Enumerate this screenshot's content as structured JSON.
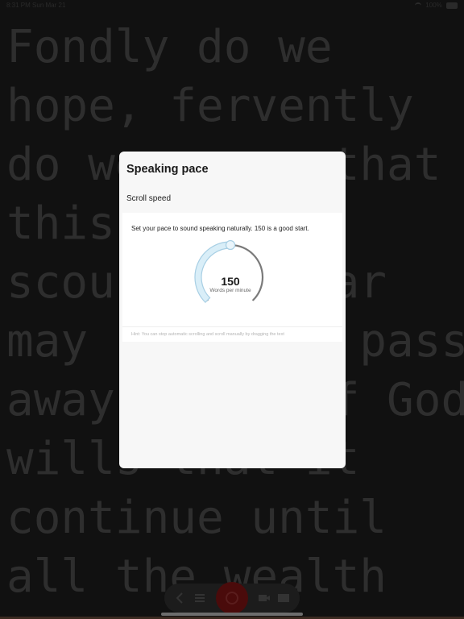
{
  "status_bar": {
    "time": "8:31 PM",
    "date": "Sun Mar 21",
    "battery": "100%"
  },
  "script": {
    "lines": [
      "Fondly do we",
      "hope, fervently",
      "do we pray, that",
      "this mighty",
      "scourge of war",
      "may speedily pass",
      "away. Yet, if God",
      "wills that it",
      "continue until",
      "all the wealth"
    ]
  },
  "dialog": {
    "title": "Speaking pace",
    "section_label": "Scroll speed",
    "description": "Set your pace to sound speaking naturally. 150 is a good start.",
    "gauge": {
      "value": "150",
      "unit": "Words per minute",
      "level_fraction": 0.5
    },
    "hint": "Hint: You can stop automatic scrolling and scroll manually by dragging the text"
  },
  "toolbar": {
    "items": [
      "back-icon",
      "menu-icon",
      "record-icon",
      "camera-icon",
      "window-icon"
    ]
  },
  "colors": {
    "gauge_fill": "#d9eef8",
    "gauge_outline": "#a8cfe4",
    "gauge_track": "#7a7a7a",
    "record_button": "#4a0b0b"
  }
}
